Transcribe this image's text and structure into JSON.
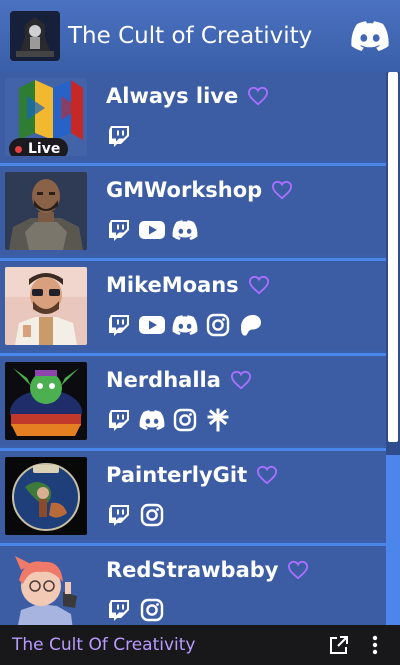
{
  "header": {
    "title": "The Cult of Creativity",
    "logo_icon": "cult-logo-icon",
    "discord_icon": "discord-icon"
  },
  "colors": {
    "accent": "#9146ff",
    "heart": "#a970ff",
    "card_bg": "#3c5da3",
    "divider": "#4a86ea",
    "footer_text": "#b99bff"
  },
  "streamers": [
    {
      "name": "Always live",
      "live": true,
      "live_label": "Live",
      "icons": [
        "twitch-icon"
      ]
    },
    {
      "name": "GMWorkshop",
      "live": false,
      "icons": [
        "twitch-icon",
        "youtube-icon",
        "discord-icon"
      ]
    },
    {
      "name": "MikeMoans",
      "live": false,
      "icons": [
        "twitch-icon",
        "youtube-icon",
        "discord-icon",
        "instagram-icon",
        "patreon-icon"
      ]
    },
    {
      "name": "Nerdhalla",
      "live": false,
      "icons": [
        "twitch-icon",
        "discord-icon",
        "instagram-icon",
        "linktree-icon"
      ]
    },
    {
      "name": "PainterlyGit",
      "live": false,
      "icons": [
        "twitch-icon",
        "instagram-icon"
      ]
    },
    {
      "name": "RedStrawbaby",
      "live": false,
      "icons": [
        "twitch-icon",
        "instagram-icon"
      ]
    }
  ],
  "footer": {
    "brand": "The Cult Of Creativity",
    "popout_icon": "external-link-icon",
    "menu_icon": "more-vertical-icon"
  }
}
